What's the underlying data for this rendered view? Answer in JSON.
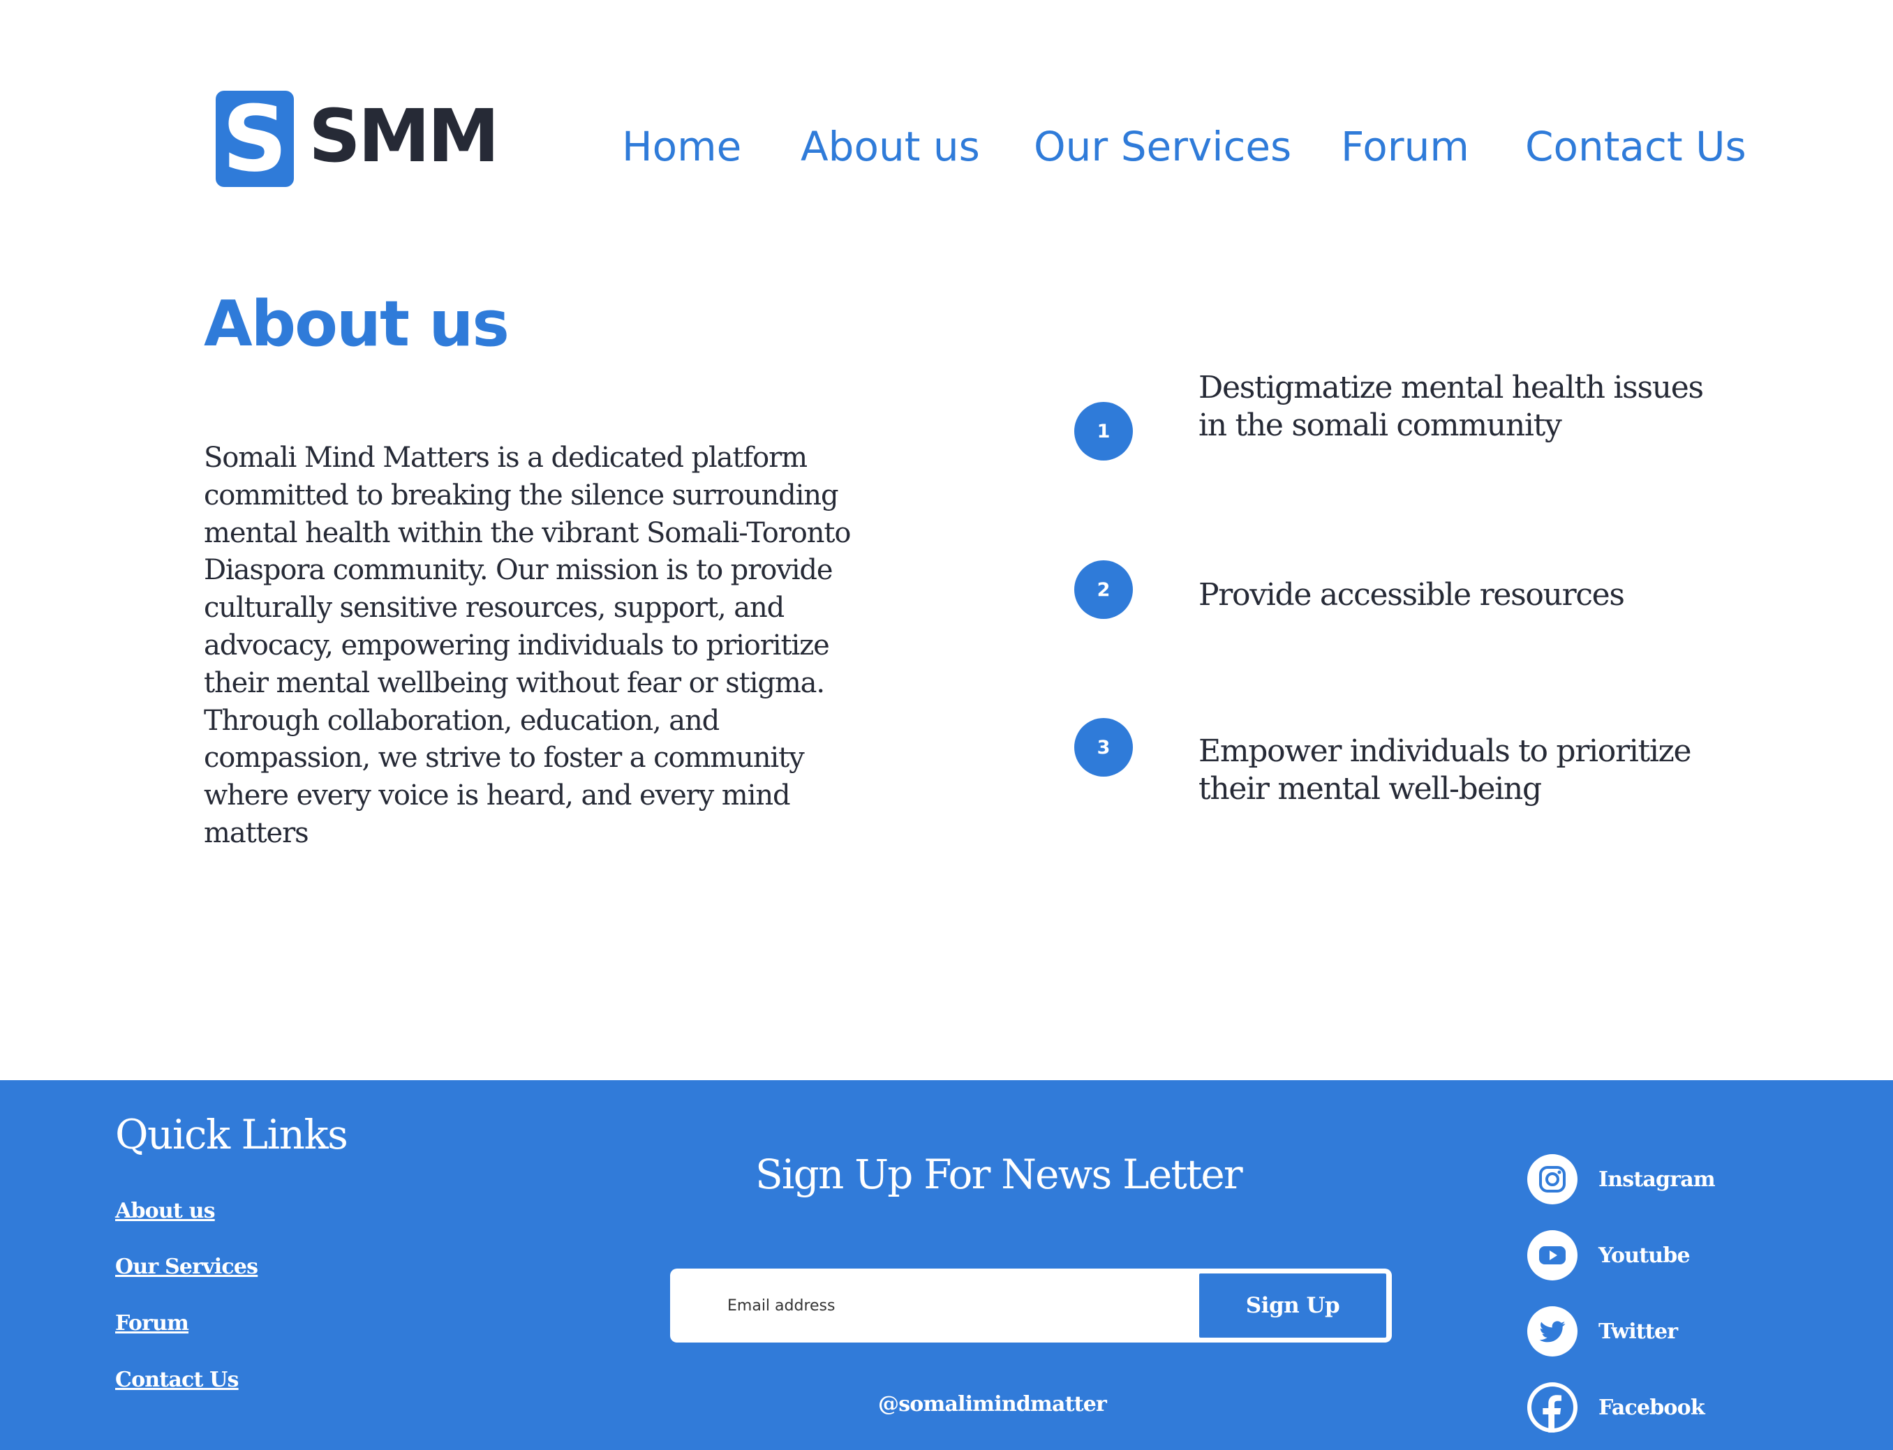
{
  "brand": {
    "logo_letter": "S",
    "logo_wordmark": "SMM"
  },
  "nav": {
    "items": [
      "Home",
      "About us",
      "Our Services",
      "Forum",
      "Contact Us"
    ]
  },
  "about": {
    "title": "About us",
    "body_lines": [
      "Somali Mind Matters is a dedicated platform",
      "committed to breaking the silence surrounding",
      "mental health within the vibrant Somali-Toronto",
      "Diaspora community. Our mission is to provide",
      "culturally sensitive resources, support, and",
      "advocacy, empowering individuals to prioritize",
      "their mental wellbeing without fear or stigma.",
      "Through collaboration, education, and",
      "compassion, we strive to foster a community",
      "where every voice is heard, and every mind",
      "matters"
    ],
    "goals": [
      {
        "number": "1",
        "lines": [
          "Destigmatize mental health issues",
          "in the somali community"
        ]
      },
      {
        "number": "2",
        "lines": [
          "Provide accessible resources"
        ]
      },
      {
        "number": "3",
        "lines": [
          "Empower individuals to prioritize",
          "their mental well-being"
        ]
      }
    ]
  },
  "footer": {
    "quick_links_title": "Quick Links",
    "quick_links": [
      "About us",
      "Our Services",
      "Forum",
      "Contact Us"
    ],
    "newsletter_title": "Sign Up For News Letter",
    "email_placeholder": "Email address",
    "signup_label": "Sign Up",
    "handle": "@somalimindmatter",
    "social": [
      {
        "label": "Instagram",
        "icon": "instagram-icon"
      },
      {
        "label": "Youtube",
        "icon": "youtube-icon"
      },
      {
        "label": "Twitter",
        "icon": "twitter-icon"
      },
      {
        "label": "Facebook",
        "icon": "facebook-icon"
      }
    ]
  },
  "colors": {
    "brand_blue": "#2f7bd9",
    "footer_blue": "#317bd9",
    "text_dark": "#262a36",
    "background": "#ffffff"
  }
}
